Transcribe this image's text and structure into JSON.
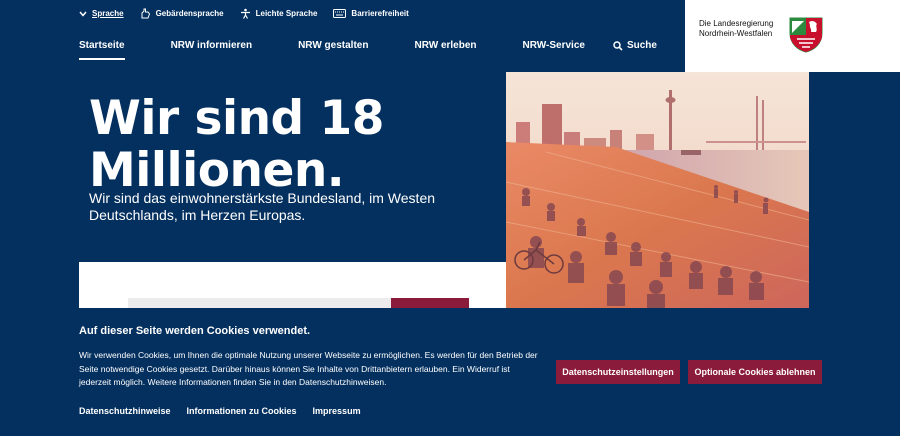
{
  "utility_bar": {
    "items": [
      {
        "label": "Sprache",
        "icon": "chevron-down-icon"
      },
      {
        "label": "Gebärdensprache",
        "icon": "sign-language-icon"
      },
      {
        "label": "Leichte Sprache",
        "icon": "easy-language-icon"
      },
      {
        "label": "Barrierefreiheit",
        "icon": "keyboard-icon"
      }
    ]
  },
  "nav": {
    "items": [
      {
        "label": "Startseite",
        "active": true
      },
      {
        "label": "NRW informieren"
      },
      {
        "label": "NRW gestalten"
      },
      {
        "label": "NRW erleben"
      },
      {
        "label": "NRW-Service"
      }
    ],
    "search_label": "Suche"
  },
  "brand": {
    "line1": "Die Landesregierung",
    "line2": "Nordrhein-Westfalen",
    "logo": "nrw-coat-of-arms"
  },
  "hero": {
    "title_line1": "Wir sind 18",
    "title_line2": "Millionen.",
    "subtitle": "Wir sind das einwohnerstärkste Bundesland, im Westen Deutschlands, im Herzen Europas."
  },
  "cookie_banner": {
    "heading": "Auf dieser Seite werden Cookies verwendet.",
    "text": "Wir verwenden Cookies, um Ihnen die optimale Nutzung unserer Webseite zu ermöglichen. Es werden für den Betrieb der Seite notwendige Cookies gesetzt. Darüber hinaus können Sie Inhalte von Drittanbietern erlauben. Ein Widerruf ist jederzeit möglich. Weitere Informationen finden Sie in den Datenschutzhinweisen.",
    "btn_settings": "Datenschutzeinstellungen",
    "btn_reject": "Optionale Cookies ablehnen",
    "links": [
      "Datenschutzhinweise",
      "Informationen zu Cookies",
      "Impressum"
    ]
  },
  "colors": {
    "navy": "#04305f",
    "accent": "#8b1b3a"
  }
}
